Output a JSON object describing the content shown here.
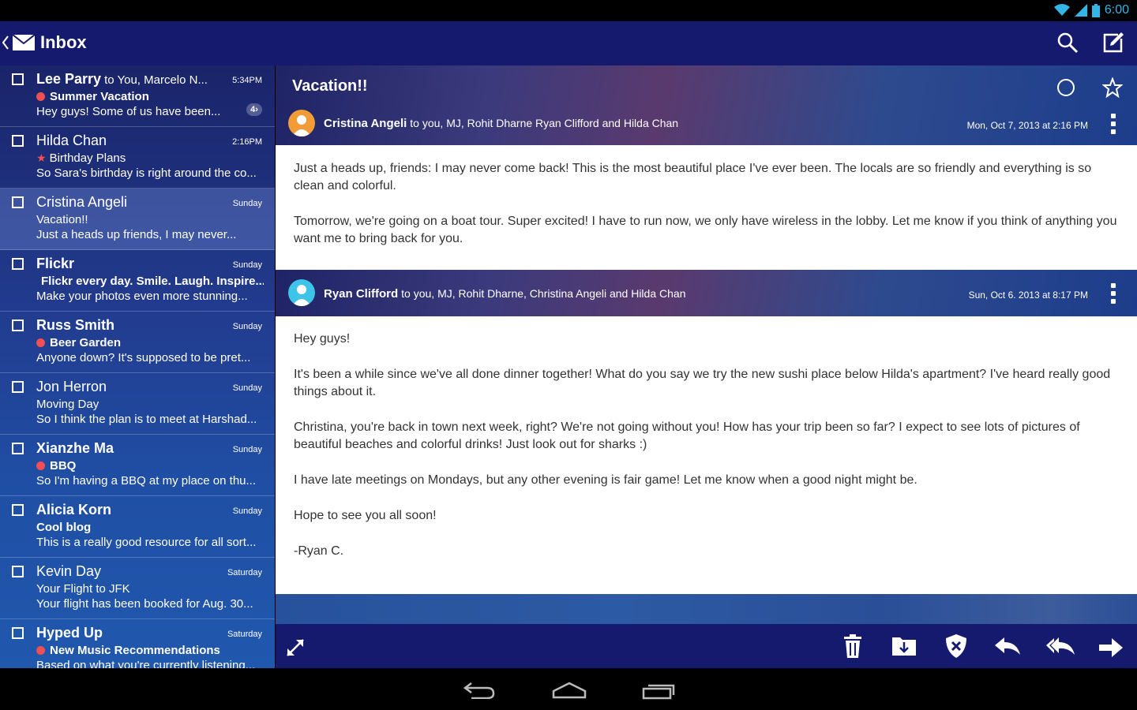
{
  "status": {
    "time": "6:00"
  },
  "actionbar": {
    "title": "Inbox"
  },
  "messages": [
    {
      "sender": "Lee Parry",
      "recipients": "to You, Marcelo N...",
      "time": "5:34PM",
      "subject": "Summer Vacation",
      "preview": "Hey guys!  Some of us have been...",
      "marker": "dot",
      "unread": true,
      "thread": "4"
    },
    {
      "sender": "Hilda Chan",
      "recipients": "",
      "time": "2:16PM",
      "subject": "Birthday Plans",
      "preview": "So Sara's birthday is right around the co...",
      "marker": "star",
      "unread": false
    },
    {
      "sender": "Cristina Angeli",
      "recipients": "",
      "time": "Sunday",
      "subject": "Vacation!!",
      "preview": "Just a heads up friends, I may never...",
      "marker": "none",
      "unread": false,
      "selected": true
    },
    {
      "sender": "Flickr",
      "recipients": "",
      "time": "Sunday",
      "subject": "Flickr every day. Smile. Laugh. Inspire...",
      "preview": "Make your photos even more stunning...",
      "marker": "dot",
      "unread": true
    },
    {
      "sender": "Russ Smith",
      "recipients": "",
      "time": "Sunday",
      "subject": "Beer Garden",
      "preview": "Anyone down? It's supposed to be pret...",
      "marker": "dot",
      "unread": true
    },
    {
      "sender": "Jon Herron",
      "recipients": "",
      "time": "Sunday",
      "subject": "Moving Day",
      "preview": "So I think the plan is to meet at Harshad...",
      "marker": "none",
      "unread": false
    },
    {
      "sender": "Xianzhe Ma",
      "recipients": "",
      "time": "Sunday",
      "subject": "BBQ",
      "preview": "So I'm having a BBQ at my place on thu...",
      "marker": "dot",
      "unread": true
    },
    {
      "sender": "Alicia Korn",
      "recipients": "",
      "time": "Sunday",
      "subject": "Cool blog",
      "preview": "This is a really good resource for all sort...",
      "marker": "none",
      "unread": true
    },
    {
      "sender": "Kevin Day",
      "recipients": "",
      "time": "Saturday",
      "subject": "Your Flight to JFK",
      "preview": "Your flight has been booked for Aug. 30...",
      "marker": "none",
      "unread": false
    },
    {
      "sender": "Hyped Up",
      "recipients": "",
      "time": "Saturday",
      "subject": "New Music Recommendations",
      "preview": "Based on what you're currently listening...",
      "marker": "dot",
      "unread": true
    }
  ],
  "reader": {
    "subject": "Vacation!!",
    "emails": [
      {
        "from": "Cristina Angeli",
        "to": "to you, MJ, Rohit Dharne Ryan Clifford and Hilda Chan",
        "date": "Mon, Oct 7, 2013 at 2:16 PM",
        "paragraphs": [
          "Just a heads up, friends: I may never come back! This is the most beautiful place I've ever been.  The locals are so friendly and everything is so clean and colorful.",
          "Tomorrow, we're going on a boat tour. Super excited! I have to run now, we only have wireless in the lobby. Let me know if you think of anything you want me to bring back for you."
        ]
      },
      {
        "from": "Ryan Clifford",
        "to": "to you, MJ, Rohit Dharne, Christina Angeli and Hilda Chan",
        "date": "Sun, Oct 6. 2013 at 8:17 PM",
        "paragraphs": [
          "Hey guys!",
          "It's been a while since we've all done dinner together! What do you say we try the new sushi place below Hilda's apartment? I've heard really good things about it.",
          "Christina, you're back in town next week, right? We're not going without you! How has your trip been so far? I expect to see lots of pictures of beautiful beaches and colorful drinks! Just look out for sharks :)",
          "I have late meetings on Mondays, but any other evening is fair game! Let me know when a good night might be.",
          "Hope to see you all soon!",
          "-Ryan C."
        ]
      }
    ]
  },
  "icons": {
    "actionbar": [
      "back-icon",
      "mail-icon",
      "search-icon",
      "compose-icon"
    ],
    "bottombar": [
      "expand-icon",
      "trash-icon",
      "move-to-folder-icon",
      "spam-shield-icon",
      "reply-icon",
      "reply-all-icon",
      "forward-icon"
    ],
    "navbar": [
      "nav-back-icon",
      "nav-home-icon",
      "nav-recents-icon"
    ]
  },
  "colors": {
    "actionbar": "#161a6e",
    "unread_dot": "#ef4f55",
    "status_accent": "#33b5e5"
  }
}
